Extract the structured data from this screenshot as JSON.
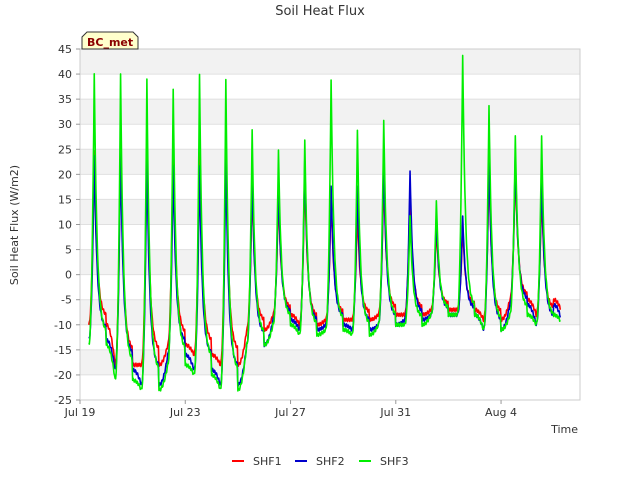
{
  "chart_data": {
    "type": "line",
    "title": "Soil Heat Flux",
    "xlabel": "Time",
    "ylabel": "Soil Heat Flux (W/m2)",
    "site_label": "BC_met",
    "ylim": [
      -25,
      45
    ],
    "yticks": [
      -25,
      -20,
      -15,
      -10,
      -5,
      0,
      5,
      10,
      15,
      20,
      25,
      30,
      35,
      40,
      45
    ],
    "xlim": [
      "2023-07-19",
      "2023-08-07"
    ],
    "xticks": [
      {
        "date": "2023-07-19",
        "label": "Jul 19"
      },
      {
        "date": "2023-07-23",
        "label": "Jul 23"
      },
      {
        "date": "2023-07-27",
        "label": "Jul 27"
      },
      {
        "date": "2023-07-31",
        "label": "Jul 31"
      },
      {
        "date": "2023-08-04",
        "label": "Aug 4"
      }
    ],
    "grid": "horizontal alternating bands",
    "legend_position": "bottom",
    "start_date": "2023-07-19T08:00",
    "end_date": "2023-08-06T06:00",
    "series": [
      {
        "name": "SHF1",
        "color": "#ff0000",
        "daily_max": [
          25,
          28,
          27,
          27,
          27,
          27,
          18,
          16,
          20,
          16,
          13,
          20,
          17,
          10,
          10,
          22,
          22,
          17
        ],
        "daily_min": [
          -10,
          -18,
          -18,
          -14,
          -16,
          -18,
          -11,
          -8,
          -10,
          -9,
          -9,
          -8,
          -8,
          -7,
          -7,
          -9,
          -5,
          -8
        ],
        "end_value": -7
      },
      {
        "name": "SHF2",
        "color": "#0000cc",
        "daily_max": [
          24,
          25,
          24,
          22,
          22,
          24,
          21,
          18,
          23,
          18,
          18,
          23,
          21,
          12,
          12,
          24,
          24,
          20
        ],
        "daily_min": [
          -13,
          -19,
          -22,
          -16,
          -19,
          -22,
          -14,
          -9,
          -11,
          -10,
          -11,
          -10,
          -9,
          -8,
          -8,
          -11,
          -6,
          -10
        ],
        "end_value": -8
      },
      {
        "name": "SHF3",
        "color": "#00ee00",
        "daily_max": [
          40,
          40,
          39,
          37,
          40,
          39,
          29,
          25,
          27,
          39,
          29,
          31,
          12,
          15,
          44,
          34,
          28,
          28
        ],
        "daily_min": [
          -14,
          -21,
          -23,
          -18,
          -20,
          -23,
          -14,
          -10,
          -12,
          -11,
          -12,
          -10,
          -10,
          -8,
          -8,
          -11,
          -8,
          -10
        ],
        "end_value": -8
      }
    ]
  }
}
